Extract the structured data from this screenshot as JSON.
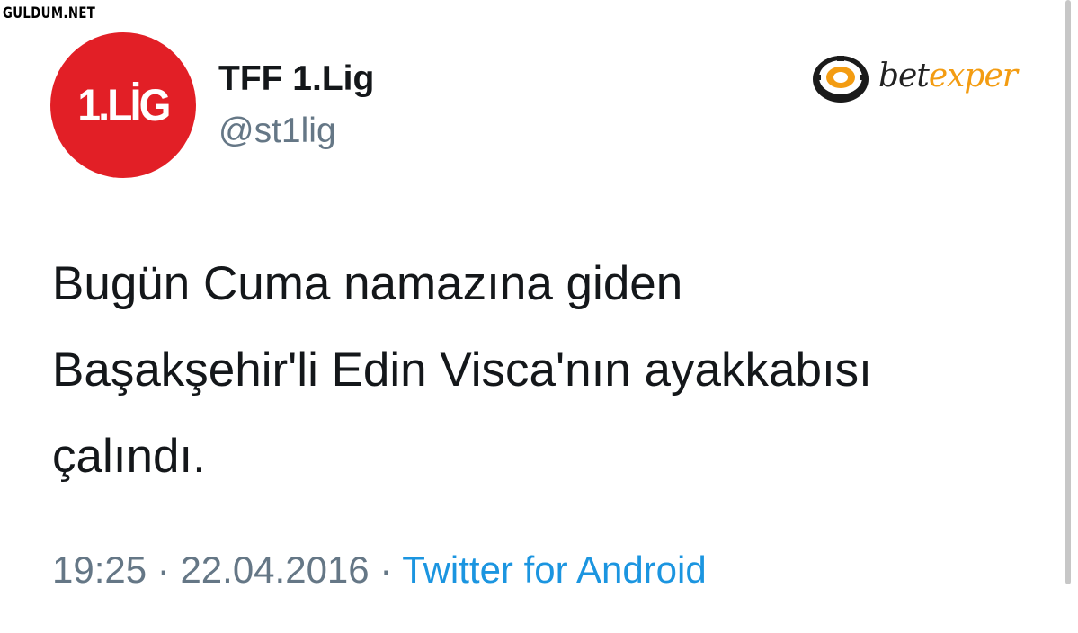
{
  "watermark": "GULDUM.NET",
  "author": {
    "avatar_text": "1.LİG",
    "display_name": "TFF 1.Lig",
    "handle": "@st1lig"
  },
  "sponsor": {
    "brand_prefix": "bet",
    "brand_suffix": "exper"
  },
  "tweet": {
    "lines": [
      "Bugün Cuma namazına giden",
      "Başakşehir'li Edin Visca'nın ayakkabısı",
      "çalındı."
    ]
  },
  "meta": {
    "time": "19:25",
    "separator": " · ",
    "date": "22.04.2016",
    "source": "Twitter for Android"
  },
  "colors": {
    "avatar_bg": "#e21f26",
    "link": "#1b95e0",
    "muted": "#657786"
  }
}
